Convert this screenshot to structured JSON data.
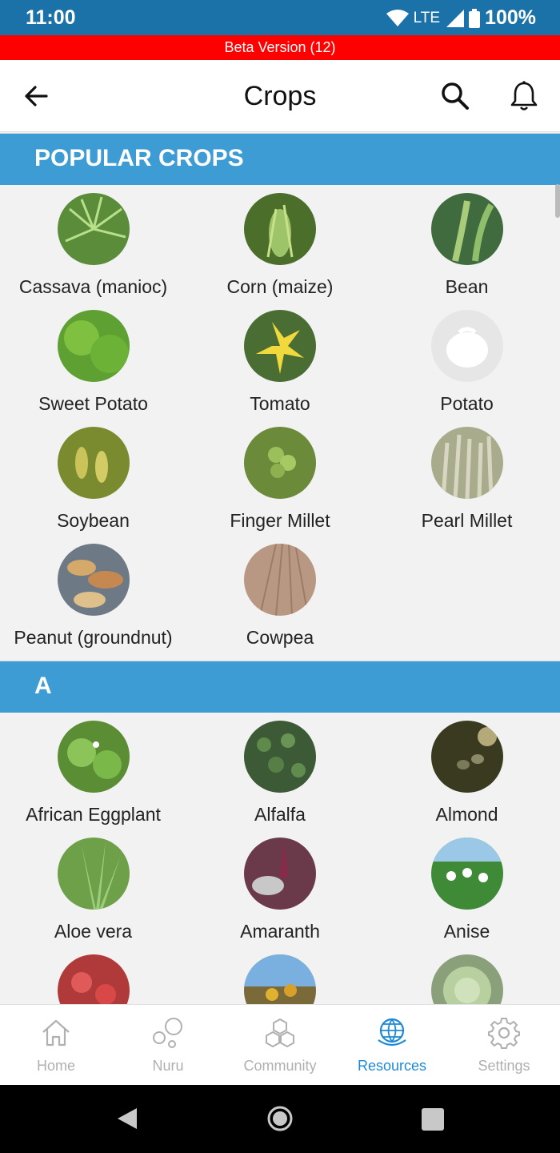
{
  "status": {
    "time": "11:00",
    "network": "LTE",
    "battery": "100%"
  },
  "beta": "Beta Version (12)",
  "appbar": {
    "title": "Crops"
  },
  "sections": [
    {
      "title": "POPULAR CROPS",
      "items": [
        {
          "label": "Cassava (manioc)",
          "bg": "#5a8c3a"
        },
        {
          "label": "Corn (maize)",
          "bg": "#4b6e2a"
        },
        {
          "label": "Bean",
          "bg": "#3f6b3e"
        },
        {
          "label": "Sweet Potato",
          "bg": "#5fa033"
        },
        {
          "label": "Tomato",
          "bg": "#4a6d34"
        },
        {
          "label": "Potato",
          "bg": "#e6e6e6"
        },
        {
          "label": "Soybean",
          "bg": "#7a8a2e"
        },
        {
          "label": "Finger Millet",
          "bg": "#6b8a3a"
        },
        {
          "label": "Pearl Millet",
          "bg": "#a8ac8c"
        },
        {
          "label": "Peanut (groundnut)",
          "bg": "#6d7a86"
        },
        {
          "label": "Cowpea",
          "bg": "#b89882"
        }
      ]
    },
    {
      "title": "A",
      "items": [
        {
          "label": "African Eggplant",
          "bg": "#5b8d35"
        },
        {
          "label": "Alfalfa",
          "bg": "#3c5a35"
        },
        {
          "label": "Almond",
          "bg": "#3a3a20"
        },
        {
          "label": "Aloe vera",
          "bg": "#6ea04a"
        },
        {
          "label": "Amaranth",
          "bg": "#6a3a4a"
        },
        {
          "label": "Anise",
          "bg": "#3e8a36"
        },
        {
          "label": "",
          "bg": "#b03a3a"
        },
        {
          "label": "",
          "bg": "#7a6a3a"
        },
        {
          "label": "",
          "bg": "#8aa07a"
        }
      ]
    }
  ],
  "nav": [
    {
      "label": "Home"
    },
    {
      "label": "Nuru"
    },
    {
      "label": "Community"
    },
    {
      "label": "Resources"
    },
    {
      "label": "Settings"
    }
  ]
}
